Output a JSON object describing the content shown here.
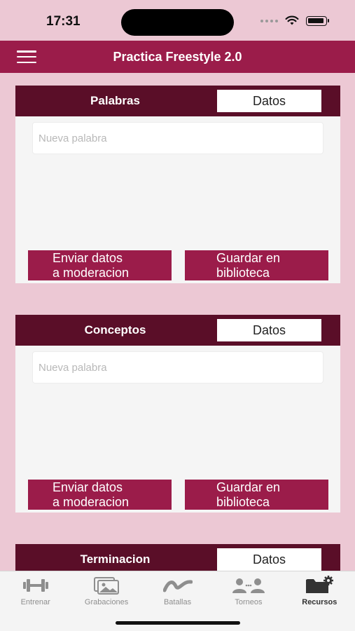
{
  "status": {
    "time": "17:31"
  },
  "header": {
    "title": "Practica Freestyle 2.0"
  },
  "cards": [
    {
      "title": "Palabras",
      "datos_label": "Datos",
      "placeholder": "Nueva palabra",
      "send_label": "Enviar datos\na moderacion",
      "save_label": "Guardar en\nbiblioteca"
    },
    {
      "title": "Conceptos",
      "datos_label": "Datos",
      "placeholder": "Nueva palabra",
      "send_label": "Enviar datos\na moderacion",
      "save_label": "Guardar en\nbiblioteca"
    },
    {
      "title": "Terminacion",
      "datos_label": "Datos"
    }
  ],
  "tabs": [
    {
      "label": "Entrenar",
      "icon": "dumbbell-icon"
    },
    {
      "label": "Grabaciones",
      "icon": "photos-icon"
    },
    {
      "label": "Batallas",
      "icon": "wave-icon"
    },
    {
      "label": "Torneos",
      "icon": "users-icon"
    },
    {
      "label": "Recursos",
      "icon": "folder-gear-icon",
      "active": true
    }
  ],
  "colors": {
    "accent": "#9b1c4a",
    "card_header": "#5a0e28",
    "background": "#ecc8d4"
  }
}
